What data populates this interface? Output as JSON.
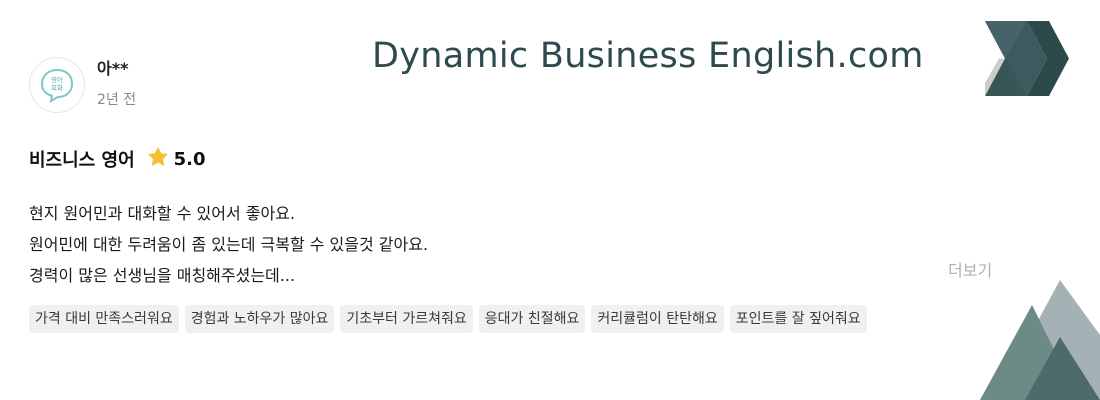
{
  "brand": {
    "title": "Dynamic Business English.com",
    "accent_color": "#2e4a4e",
    "logo_icon": "double-chevron-right-icon",
    "corner_decoration": "triangle-shapes"
  },
  "review": {
    "avatar_icon": "speech-bubble-avatar-icon",
    "avatar_text": [
      "영어",
      "회화"
    ],
    "username": "아**",
    "timestamp": "2년 전",
    "course_name": "비즈니스 영어",
    "star_icon": "star-icon",
    "star_color": "#f5c033",
    "rating": "5.0",
    "body_lines": [
      "현지 원어민과 대화할 수 있어서 좋아요.",
      "원어민에 대한 두려움이 좀 있는데 극복할 수 있을것 같아요.",
      "경력이 많은 선생님을 매칭해주셨는데..."
    ],
    "more_label": "더보기",
    "tags": [
      "가격 대비 만족스러워요",
      "경험과 노하우가 많아요",
      "기초부터 가르쳐줘요",
      "응대가 친절해요",
      "커리큘럼이 탄탄해요",
      "포인트를 잘 짚어줘요"
    ]
  }
}
